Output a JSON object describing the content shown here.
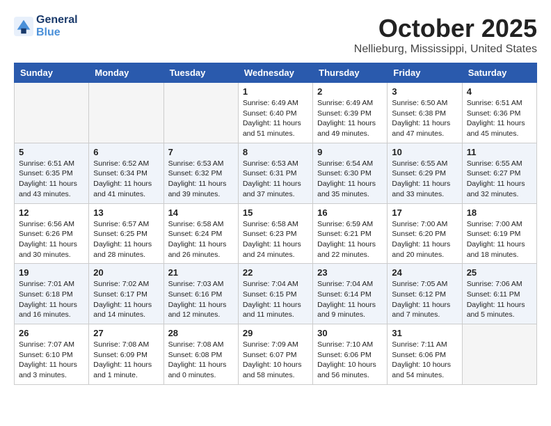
{
  "logo": {
    "line1": "General",
    "line2": "Blue"
  },
  "title": "October 2025",
  "location": "Nellieburg, Mississippi, United States",
  "weekdays": [
    "Sunday",
    "Monday",
    "Tuesday",
    "Wednesday",
    "Thursday",
    "Friday",
    "Saturday"
  ],
  "weeks": [
    [
      {
        "day": "",
        "info": ""
      },
      {
        "day": "",
        "info": ""
      },
      {
        "day": "",
        "info": ""
      },
      {
        "day": "1",
        "info": "Sunrise: 6:49 AM\nSunset: 6:40 PM\nDaylight: 11 hours\nand 51 minutes."
      },
      {
        "day": "2",
        "info": "Sunrise: 6:49 AM\nSunset: 6:39 PM\nDaylight: 11 hours\nand 49 minutes."
      },
      {
        "day": "3",
        "info": "Sunrise: 6:50 AM\nSunset: 6:38 PM\nDaylight: 11 hours\nand 47 minutes."
      },
      {
        "day": "4",
        "info": "Sunrise: 6:51 AM\nSunset: 6:36 PM\nDaylight: 11 hours\nand 45 minutes."
      }
    ],
    [
      {
        "day": "5",
        "info": "Sunrise: 6:51 AM\nSunset: 6:35 PM\nDaylight: 11 hours\nand 43 minutes."
      },
      {
        "day": "6",
        "info": "Sunrise: 6:52 AM\nSunset: 6:34 PM\nDaylight: 11 hours\nand 41 minutes."
      },
      {
        "day": "7",
        "info": "Sunrise: 6:53 AM\nSunset: 6:32 PM\nDaylight: 11 hours\nand 39 minutes."
      },
      {
        "day": "8",
        "info": "Sunrise: 6:53 AM\nSunset: 6:31 PM\nDaylight: 11 hours\nand 37 minutes."
      },
      {
        "day": "9",
        "info": "Sunrise: 6:54 AM\nSunset: 6:30 PM\nDaylight: 11 hours\nand 35 minutes."
      },
      {
        "day": "10",
        "info": "Sunrise: 6:55 AM\nSunset: 6:29 PM\nDaylight: 11 hours\nand 33 minutes."
      },
      {
        "day": "11",
        "info": "Sunrise: 6:55 AM\nSunset: 6:27 PM\nDaylight: 11 hours\nand 32 minutes."
      }
    ],
    [
      {
        "day": "12",
        "info": "Sunrise: 6:56 AM\nSunset: 6:26 PM\nDaylight: 11 hours\nand 30 minutes."
      },
      {
        "day": "13",
        "info": "Sunrise: 6:57 AM\nSunset: 6:25 PM\nDaylight: 11 hours\nand 28 minutes."
      },
      {
        "day": "14",
        "info": "Sunrise: 6:58 AM\nSunset: 6:24 PM\nDaylight: 11 hours\nand 26 minutes."
      },
      {
        "day": "15",
        "info": "Sunrise: 6:58 AM\nSunset: 6:23 PM\nDaylight: 11 hours\nand 24 minutes."
      },
      {
        "day": "16",
        "info": "Sunrise: 6:59 AM\nSunset: 6:21 PM\nDaylight: 11 hours\nand 22 minutes."
      },
      {
        "day": "17",
        "info": "Sunrise: 7:00 AM\nSunset: 6:20 PM\nDaylight: 11 hours\nand 20 minutes."
      },
      {
        "day": "18",
        "info": "Sunrise: 7:00 AM\nSunset: 6:19 PM\nDaylight: 11 hours\nand 18 minutes."
      }
    ],
    [
      {
        "day": "19",
        "info": "Sunrise: 7:01 AM\nSunset: 6:18 PM\nDaylight: 11 hours\nand 16 minutes."
      },
      {
        "day": "20",
        "info": "Sunrise: 7:02 AM\nSunset: 6:17 PM\nDaylight: 11 hours\nand 14 minutes."
      },
      {
        "day": "21",
        "info": "Sunrise: 7:03 AM\nSunset: 6:16 PM\nDaylight: 11 hours\nand 12 minutes."
      },
      {
        "day": "22",
        "info": "Sunrise: 7:04 AM\nSunset: 6:15 PM\nDaylight: 11 hours\nand 11 minutes."
      },
      {
        "day": "23",
        "info": "Sunrise: 7:04 AM\nSunset: 6:14 PM\nDaylight: 11 hours\nand 9 minutes."
      },
      {
        "day": "24",
        "info": "Sunrise: 7:05 AM\nSunset: 6:12 PM\nDaylight: 11 hours\nand 7 minutes."
      },
      {
        "day": "25",
        "info": "Sunrise: 7:06 AM\nSunset: 6:11 PM\nDaylight: 11 hours\nand 5 minutes."
      }
    ],
    [
      {
        "day": "26",
        "info": "Sunrise: 7:07 AM\nSunset: 6:10 PM\nDaylight: 11 hours\nand 3 minutes."
      },
      {
        "day": "27",
        "info": "Sunrise: 7:08 AM\nSunset: 6:09 PM\nDaylight: 11 hours\nand 1 minute."
      },
      {
        "day": "28",
        "info": "Sunrise: 7:08 AM\nSunset: 6:08 PM\nDaylight: 11 hours\nand 0 minutes."
      },
      {
        "day": "29",
        "info": "Sunrise: 7:09 AM\nSunset: 6:07 PM\nDaylight: 10 hours\nand 58 minutes."
      },
      {
        "day": "30",
        "info": "Sunrise: 7:10 AM\nSunset: 6:06 PM\nDaylight: 10 hours\nand 56 minutes."
      },
      {
        "day": "31",
        "info": "Sunrise: 7:11 AM\nSunset: 6:06 PM\nDaylight: 10 hours\nand 54 minutes."
      },
      {
        "day": "",
        "info": ""
      }
    ]
  ]
}
